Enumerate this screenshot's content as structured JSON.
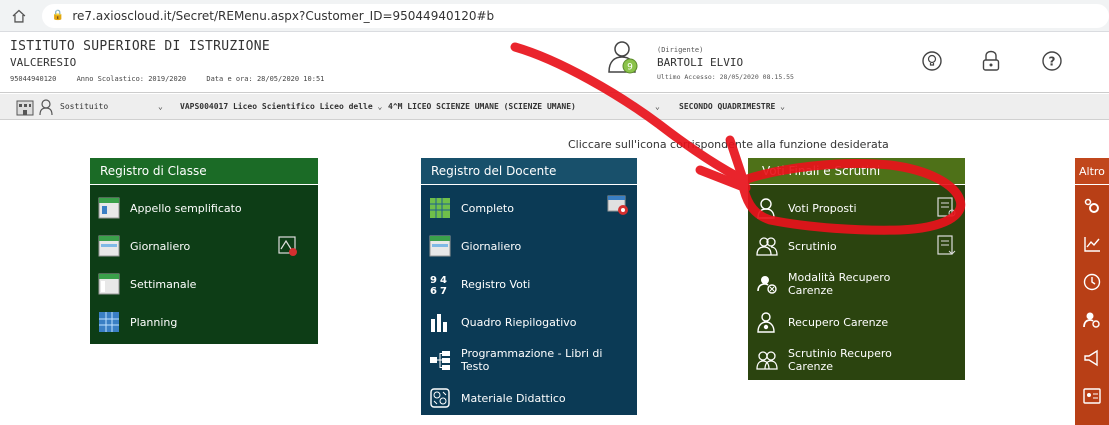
{
  "browser": {
    "url": "re7.axioscloud.it/Secret/REMenu.aspx?Customer_ID=95044940120#b"
  },
  "header": {
    "school_name": "ISTITUTO SUPERIORE DI ISTRUZIONE",
    "school_sub": "VALCERESIO",
    "code": "95044940120",
    "year": "Anno Scolastico: 2019/2020",
    "datetime": "Data e ora: 28/05/2020 10:51",
    "user_badge": "9",
    "role": "(Dirigente)",
    "user_name": "BARTOLI ELVIO",
    "last_access": "Ultimo Accesso: 28/05/2020 08.15.55"
  },
  "toolbar": {
    "sostituito": "Sostituito",
    "school_select": "VAPS004017 Liceo Scientifico Liceo delle",
    "class_select": "4^M LICEO SCIENZE UMANE (SCIENZE UMANE)",
    "period_select": "SECONDO QUADRIMESTRE",
    "chevron": "⌄"
  },
  "hint": "Cliccare sull'icona corrispondente alla funzione desiderata",
  "panels": {
    "classe": {
      "title": "Registro di Classe",
      "items": [
        "Appello semplificato",
        "Giornaliero",
        "Settimanale",
        "Planning"
      ]
    },
    "docente": {
      "title": "Registro del Docente",
      "items": [
        "Completo",
        "Giornaliero",
        "Registro Voti",
        "Quadro Riepilogativo",
        "Programmazione - Libri di",
        "Testo",
        "Materiale Didattico"
      ]
    },
    "voti": {
      "title": "Voti Finali e Scrutini",
      "items": [
        "Voti Proposti",
        "Scrutinio",
        "Modalità Recupero",
        "Carenze",
        "Recupero Carenze",
        "Scrutinio Recupero",
        "Carenze"
      ]
    },
    "altro": {
      "title": "Altro"
    }
  },
  "colors": {
    "classe_header": "#1b6b26",
    "classe_body": "#0d3d16",
    "docente_header": "#18506b",
    "docente_body": "#0b3a55",
    "voti_header": "#4e7118",
    "voti_body": "#2b440f",
    "altro": "#c1471c",
    "ink": "#e8121b"
  }
}
